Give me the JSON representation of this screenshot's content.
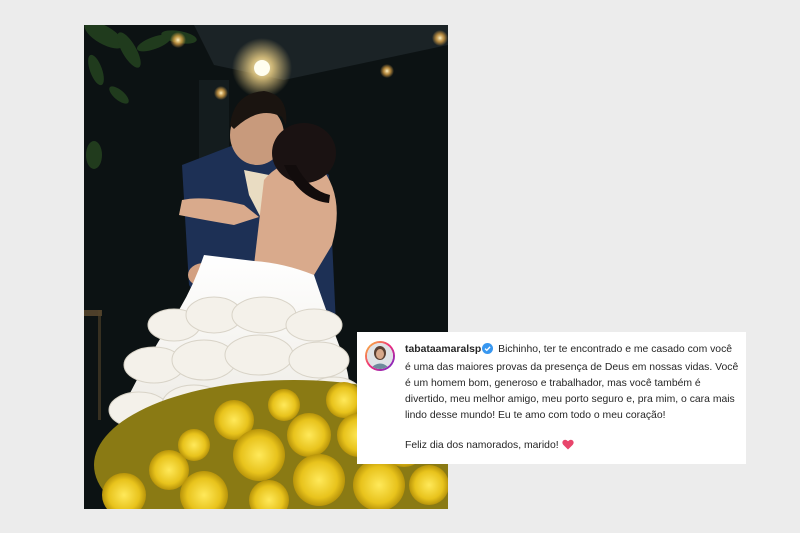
{
  "post": {
    "username": "tabataamaralsp",
    "caption_p1": "Bichinho, ter te encontrado e me casado com você é uma das maiores provas da presença de Deus em nossas vidas. Você é um homem bom, generoso e trabalhador, mas você também é divertido, meu melhor amigo, meu porto seguro e, pra mim, o cara mais lindo desse mundo! Eu te amo com todo o meu coração!",
    "caption_p2": "Feliz dia dos namorados, marido!"
  },
  "icons": {
    "verified": "verified-badge-icon",
    "heart": "heart-emoji-icon"
  },
  "colors": {
    "background": "#ececec",
    "verified_blue": "#3897f0",
    "heart": "#e8456b",
    "text": "#262626"
  }
}
